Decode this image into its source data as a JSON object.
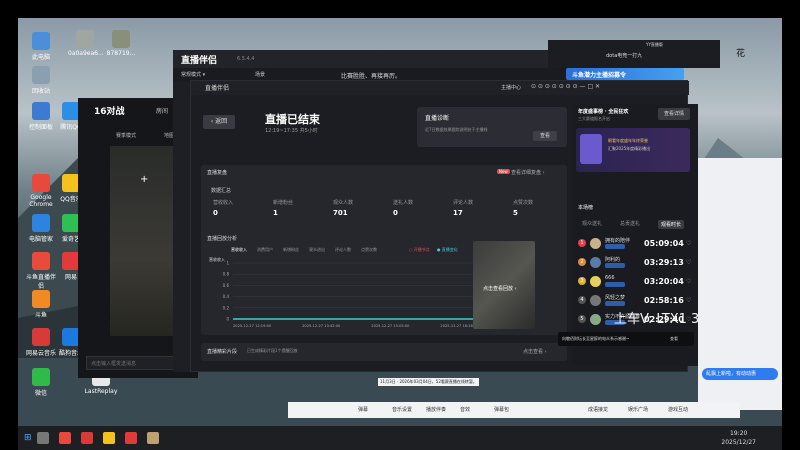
{
  "desktop": {
    "icons": [
      {
        "label": "此电脑",
        "color": "#4a8fd8"
      },
      {
        "label": "回收站",
        "color": "#8aa0b0"
      },
      {
        "label": "控制面板",
        "color": "#3d7bd0"
      },
      {
        "label": "Google Chrome",
        "color": "#e8493d"
      },
      {
        "label": "电脑管家",
        "color": "#2f83e0"
      },
      {
        "label": "斗鱼直播伴侣",
        "color": "#e84b3c"
      },
      {
        "label": "斗鱼",
        "color": "#f08a24"
      },
      {
        "label": "网易云音乐",
        "color": "#d83a3a"
      },
      {
        "label": "微信",
        "color": "#2fba4a"
      },
      {
        "label": "爱奇艺",
        "color": "#2fbf55"
      },
      {
        "label": "QQ音乐",
        "color": "#f3c21c"
      },
      {
        "label": "腾讯QQ",
        "color": "#2b8fe6"
      },
      {
        "label": "网易",
        "color": "#e03a3a"
      },
      {
        "label": "酷狗音乐",
        "color": "#1c79e0"
      },
      {
        "label": "LastReplay",
        "color": "#e8e8e8"
      }
    ],
    "mid_icons": [
      {
        "label": "0a0a9ea6...",
        "color": "#9aa"
      },
      {
        "label": "878719...",
        "color": "#8a9"
      }
    ]
  },
  "game_window": {
    "title": "16对战",
    "subtitle": "房间",
    "menu": [
      "赛季模式",
      "地图"
    ],
    "plus": "+",
    "chat_placeholder": "点击输入框发送消息"
  },
  "main_window": {
    "title": "直播伴侣",
    "version": "6.5.4.4",
    "top_menu": "常规模式 ▾",
    "top_tab": "场景",
    "ad_text": "比赛胜胜、再接再厉。",
    "window_controls": [
      "—",
      "□",
      "✕"
    ]
  },
  "modal": {
    "brand": "直播伴侣",
    "user": "主播中心",
    "back_label": "返回",
    "title": "直播已结束",
    "time_range": "12:19~17:35 共5小时",
    "diag_title": "直播诊断",
    "diag_desc": "近7日数据效果跟踪说明处于主播线",
    "diag_btn": "查看",
    "review_label": "直播复盘",
    "new_badge": "New",
    "review_link": "查看详细复盘 ›",
    "summary_title": "数据汇总",
    "stats": [
      {
        "label": "营收收入",
        "value": "0"
      },
      {
        "label": "新增粉丝",
        "value": "1"
      },
      {
        "label": "观众人数",
        "value": "701"
      },
      {
        "label": "送礼人数",
        "value": "0"
      },
      {
        "label": "评论人数",
        "value": "17"
      },
      {
        "label": "点赞次数",
        "value": "5"
      }
    ],
    "trend_title": "直播回放分析",
    "chart_tabs": [
      "营收收入",
      "消费用户",
      "新增粉丝",
      "观众进出",
      "评论人数",
      "点赞次数"
    ],
    "legend": [
      "○ 开播节点",
      "● 直播变化"
    ],
    "play_label": "点击查看回放 ›",
    "clip_title": "直播精彩片段",
    "clip_desc": "已生成精彩片段1个提醒回放",
    "clip_link": "点击查看 ›"
  },
  "chart_data": {
    "type": "line",
    "title": "",
    "xlabel": "",
    "ylabel": "",
    "x": [
      "2025-12-27 12:19:00",
      "2025-12-27 13:42:00",
      "2025-12-27 15:05:00",
      "2025-12-27 16:28:00"
    ],
    "y_ticks": [
      0,
      0.2,
      0.4,
      0.6,
      0.8,
      1
    ],
    "ylim": [
      0,
      1
    ],
    "first_column_label": "营收收入",
    "series": [
      {
        "values": [
          0,
          0,
          0,
          0,
          0
        ],
        "color": "#3fd0c8"
      }
    ],
    "grid": true
  },
  "right_panel": {
    "card_title": "年度盛事榜 · 全民狂欢",
    "card_sub": "三大赛道报名开启",
    "card_btn": "查看详情",
    "card_promo": "眼看年度盛年年终荣誉",
    "card_promo2": "汇聚2025年度精彩播出",
    "ranking_title": "本场榜",
    "tabs": [
      "观众送礼",
      "总贡送礼",
      "观看时长"
    ],
    "rows": [
      {
        "rank": "1",
        "name": "拥有的陪伴",
        "time": "05:09:04",
        "rank_color": "#e0424a",
        "avatar": "#c9b28a"
      },
      {
        "rank": "2",
        "name": "阿利的",
        "time": "03:29:13",
        "rank_color": "#e08a3a",
        "avatar": "#5a7aa8"
      },
      {
        "rank": "3",
        "name": "666",
        "time": "03:20:04",
        "rank_color": "#d8b03a",
        "avatar": "#e8d060"
      },
      {
        "rank": "4",
        "name": "风轻之梦",
        "time": "02:58:16",
        "rank_color": "#555",
        "avatar": "#777"
      },
      {
        "rank": "5",
        "name": "实力不许源疆舞",
        "time": "02:29:40",
        "rank_color": "#555",
        "avatar": "#8aa88a"
      },
      {
        "rank": "6",
        "name": "邵明",
        "time": "",
        "rank_color": "#555",
        "avatar": "#a87a6a"
      }
    ],
    "toast": "向敬佰财坛长至星醉的电众系示感谢~",
    "toast_btn": "查看",
    "overlay_text": "上车V: LTX1 3236"
  },
  "top_bar": {
    "tag": "YY直播版",
    "username": "dota电竞一打九",
    "banner": "斗鱼潜力主播招募令",
    "corner": "花"
  },
  "side_chat": {
    "bubble": "乱飘上新啦，有动动惠",
    "items": [
      "直播中",
      "助手"
    ]
  },
  "bottom_bar": {
    "items": [
      "弹幕",
      "音乐设置",
      "播放伴奏",
      "音效",
      "弹幕包"
    ],
    "right_items": [
      "成语接龙",
      "娱乐广场",
      "游戏互动"
    ],
    "bottom_texts": [
      "11月3日 · 2026年03月04日，52看赛直播在线转暂。"
    ]
  },
  "clock": {
    "time": "19:20",
    "date": "2025/12/27"
  }
}
